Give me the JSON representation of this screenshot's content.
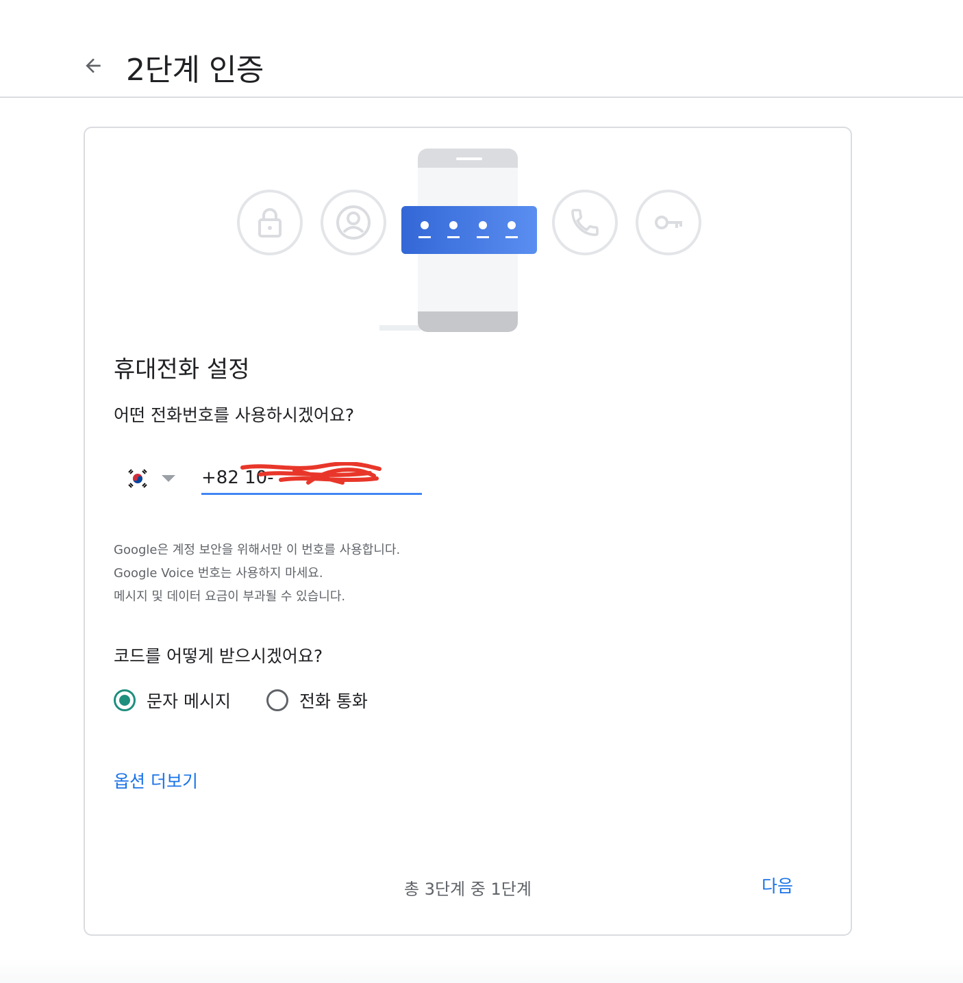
{
  "header": {
    "title": "2단계 인증"
  },
  "setup": {
    "title": "휴대전화 설정",
    "question": "어떤 전화번호를 사용하시겠어요?",
    "phone_value": "+82 10-",
    "disclaimer_lines": [
      "Google은 계정 보안을 위해서만 이 번호를 사용합니다.",
      "Google Voice 번호는 사용하지 마세요.",
      "메시지 및 데이터 요금이 부과될 수 있습니다."
    ]
  },
  "delivery": {
    "question": "코드를 어떻게 받으시겠어요?",
    "options": [
      {
        "label": "문자 메시지",
        "checked": true
      },
      {
        "label": "전화 통화",
        "checked": false
      }
    ]
  },
  "more_options": "옵션 더보기",
  "footer": {
    "step": "총 3단계 중 1단계",
    "next": "다음"
  },
  "colors": {
    "accent_blue": "#1a73e8",
    "underline_blue": "#4285f4",
    "radio_checked": "#1e8e7e",
    "card_banner_blue": "#4a80e8"
  }
}
